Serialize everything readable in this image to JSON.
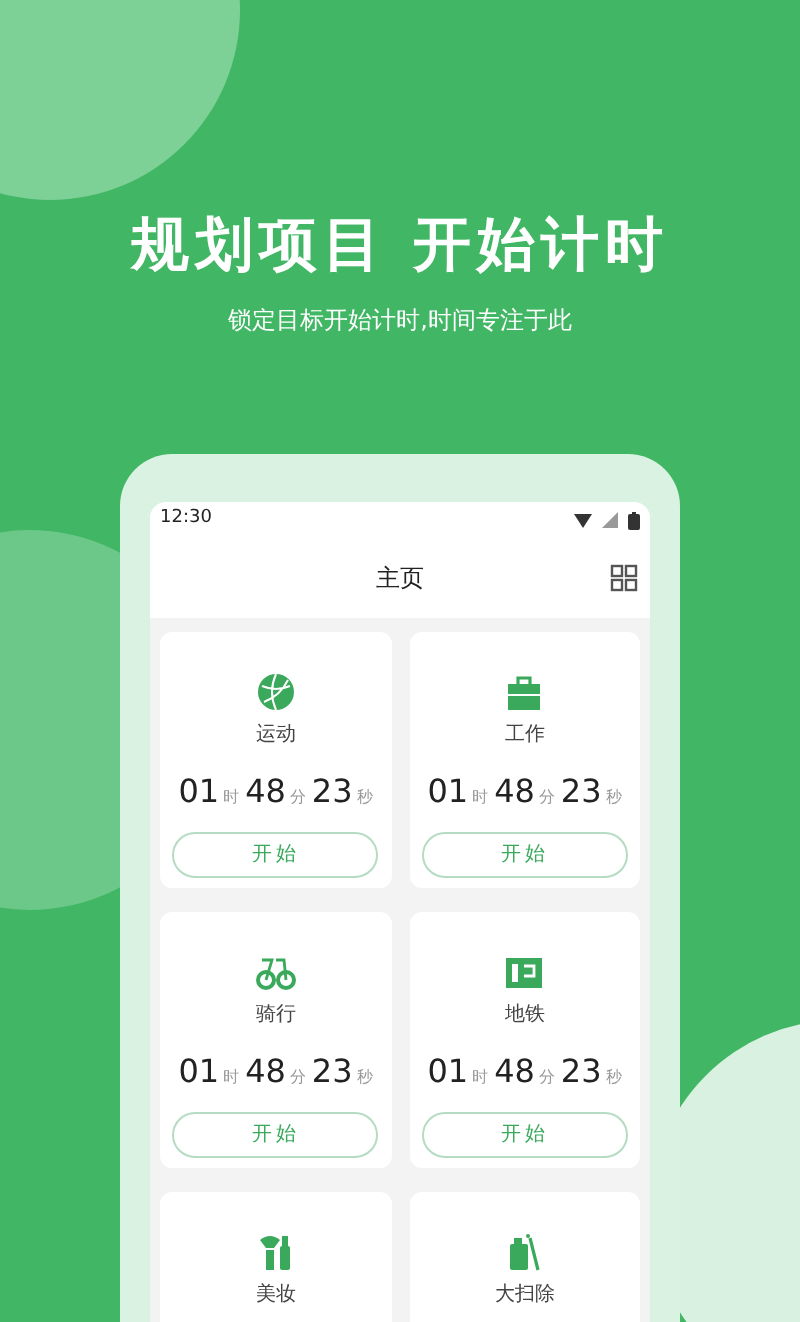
{
  "headline": "规划项目 开始计时",
  "subtitle": "锁定目标开始计时,时间专注于此",
  "phone": {
    "status_bar": {
      "time": "12:30"
    },
    "header": {
      "title": "主页"
    },
    "cards": [
      {
        "name": "运动",
        "hours": "01",
        "hours_unit": "时",
        "minutes": "48",
        "minutes_unit": "分",
        "seconds": "23",
        "seconds_unit": "秒",
        "button": "开始"
      },
      {
        "name": "工作",
        "hours": "01",
        "hours_unit": "时",
        "minutes": "48",
        "minutes_unit": "分",
        "seconds": "23",
        "seconds_unit": "秒",
        "button": "开始"
      },
      {
        "name": "骑行",
        "hours": "01",
        "hours_unit": "时",
        "minutes": "48",
        "minutes_unit": "分",
        "seconds": "23",
        "seconds_unit": "秒",
        "button": "开始"
      },
      {
        "name": "地铁",
        "hours": "01",
        "hours_unit": "时",
        "minutes": "48",
        "minutes_unit": "分",
        "seconds": "23",
        "seconds_unit": "秒",
        "button": "开始"
      },
      {
        "name": "美妆"
      },
      {
        "name": "大扫除"
      }
    ]
  }
}
